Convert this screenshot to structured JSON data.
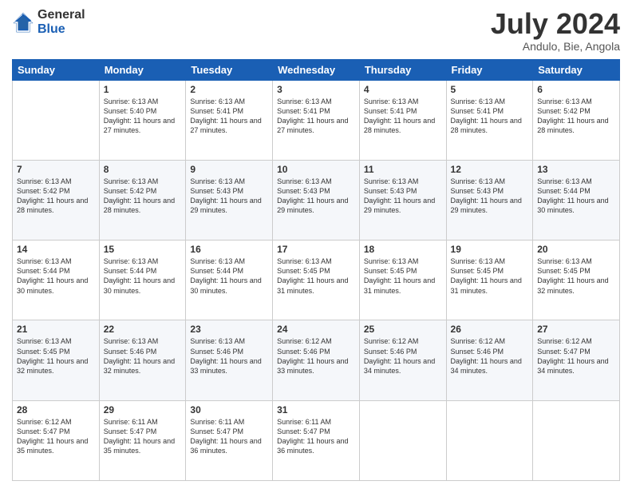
{
  "logo": {
    "general": "General",
    "blue": "Blue"
  },
  "header": {
    "month_year": "July 2024",
    "location": "Andulo, Bie, Angola"
  },
  "days_header": [
    "Sunday",
    "Monday",
    "Tuesday",
    "Wednesday",
    "Thursday",
    "Friday",
    "Saturday"
  ],
  "weeks": [
    [
      {
        "day": "",
        "sunrise": "",
        "sunset": "",
        "daylight": ""
      },
      {
        "day": "1",
        "sunrise": "Sunrise: 6:13 AM",
        "sunset": "Sunset: 5:40 PM",
        "daylight": "Daylight: 11 hours and 27 minutes."
      },
      {
        "day": "2",
        "sunrise": "Sunrise: 6:13 AM",
        "sunset": "Sunset: 5:41 PM",
        "daylight": "Daylight: 11 hours and 27 minutes."
      },
      {
        "day": "3",
        "sunrise": "Sunrise: 6:13 AM",
        "sunset": "Sunset: 5:41 PM",
        "daylight": "Daylight: 11 hours and 27 minutes."
      },
      {
        "day": "4",
        "sunrise": "Sunrise: 6:13 AM",
        "sunset": "Sunset: 5:41 PM",
        "daylight": "Daylight: 11 hours and 28 minutes."
      },
      {
        "day": "5",
        "sunrise": "Sunrise: 6:13 AM",
        "sunset": "Sunset: 5:41 PM",
        "daylight": "Daylight: 11 hours and 28 minutes."
      },
      {
        "day": "6",
        "sunrise": "Sunrise: 6:13 AM",
        "sunset": "Sunset: 5:42 PM",
        "daylight": "Daylight: 11 hours and 28 minutes."
      }
    ],
    [
      {
        "day": "7",
        "sunrise": "Sunrise: 6:13 AM",
        "sunset": "Sunset: 5:42 PM",
        "daylight": "Daylight: 11 hours and 28 minutes."
      },
      {
        "day": "8",
        "sunrise": "Sunrise: 6:13 AM",
        "sunset": "Sunset: 5:42 PM",
        "daylight": "Daylight: 11 hours and 28 minutes."
      },
      {
        "day": "9",
        "sunrise": "Sunrise: 6:13 AM",
        "sunset": "Sunset: 5:43 PM",
        "daylight": "Daylight: 11 hours and 29 minutes."
      },
      {
        "day": "10",
        "sunrise": "Sunrise: 6:13 AM",
        "sunset": "Sunset: 5:43 PM",
        "daylight": "Daylight: 11 hours and 29 minutes."
      },
      {
        "day": "11",
        "sunrise": "Sunrise: 6:13 AM",
        "sunset": "Sunset: 5:43 PM",
        "daylight": "Daylight: 11 hours and 29 minutes."
      },
      {
        "day": "12",
        "sunrise": "Sunrise: 6:13 AM",
        "sunset": "Sunset: 5:43 PM",
        "daylight": "Daylight: 11 hours and 29 minutes."
      },
      {
        "day": "13",
        "sunrise": "Sunrise: 6:13 AM",
        "sunset": "Sunset: 5:44 PM",
        "daylight": "Daylight: 11 hours and 30 minutes."
      }
    ],
    [
      {
        "day": "14",
        "sunrise": "Sunrise: 6:13 AM",
        "sunset": "Sunset: 5:44 PM",
        "daylight": "Daylight: 11 hours and 30 minutes."
      },
      {
        "day": "15",
        "sunrise": "Sunrise: 6:13 AM",
        "sunset": "Sunset: 5:44 PM",
        "daylight": "Daylight: 11 hours and 30 minutes."
      },
      {
        "day": "16",
        "sunrise": "Sunrise: 6:13 AM",
        "sunset": "Sunset: 5:44 PM",
        "daylight": "Daylight: 11 hours and 30 minutes."
      },
      {
        "day": "17",
        "sunrise": "Sunrise: 6:13 AM",
        "sunset": "Sunset: 5:45 PM",
        "daylight": "Daylight: 11 hours and 31 minutes."
      },
      {
        "day": "18",
        "sunrise": "Sunrise: 6:13 AM",
        "sunset": "Sunset: 5:45 PM",
        "daylight": "Daylight: 11 hours and 31 minutes."
      },
      {
        "day": "19",
        "sunrise": "Sunrise: 6:13 AM",
        "sunset": "Sunset: 5:45 PM",
        "daylight": "Daylight: 11 hours and 31 minutes."
      },
      {
        "day": "20",
        "sunrise": "Sunrise: 6:13 AM",
        "sunset": "Sunset: 5:45 PM",
        "daylight": "Daylight: 11 hours and 32 minutes."
      }
    ],
    [
      {
        "day": "21",
        "sunrise": "Sunrise: 6:13 AM",
        "sunset": "Sunset: 5:45 PM",
        "daylight": "Daylight: 11 hours and 32 minutes."
      },
      {
        "day": "22",
        "sunrise": "Sunrise: 6:13 AM",
        "sunset": "Sunset: 5:46 PM",
        "daylight": "Daylight: 11 hours and 32 minutes."
      },
      {
        "day": "23",
        "sunrise": "Sunrise: 6:13 AM",
        "sunset": "Sunset: 5:46 PM",
        "daylight": "Daylight: 11 hours and 33 minutes."
      },
      {
        "day": "24",
        "sunrise": "Sunrise: 6:12 AM",
        "sunset": "Sunset: 5:46 PM",
        "daylight": "Daylight: 11 hours and 33 minutes."
      },
      {
        "day": "25",
        "sunrise": "Sunrise: 6:12 AM",
        "sunset": "Sunset: 5:46 PM",
        "daylight": "Daylight: 11 hours and 34 minutes."
      },
      {
        "day": "26",
        "sunrise": "Sunrise: 6:12 AM",
        "sunset": "Sunset: 5:46 PM",
        "daylight": "Daylight: 11 hours and 34 minutes."
      },
      {
        "day": "27",
        "sunrise": "Sunrise: 6:12 AM",
        "sunset": "Sunset: 5:47 PM",
        "daylight": "Daylight: 11 hours and 34 minutes."
      }
    ],
    [
      {
        "day": "28",
        "sunrise": "Sunrise: 6:12 AM",
        "sunset": "Sunset: 5:47 PM",
        "daylight": "Daylight: 11 hours and 35 minutes."
      },
      {
        "day": "29",
        "sunrise": "Sunrise: 6:11 AM",
        "sunset": "Sunset: 5:47 PM",
        "daylight": "Daylight: 11 hours and 35 minutes."
      },
      {
        "day": "30",
        "sunrise": "Sunrise: 6:11 AM",
        "sunset": "Sunset: 5:47 PM",
        "daylight": "Daylight: 11 hours and 36 minutes."
      },
      {
        "day": "31",
        "sunrise": "Sunrise: 6:11 AM",
        "sunset": "Sunset: 5:47 PM",
        "daylight": "Daylight: 11 hours and 36 minutes."
      },
      {
        "day": "",
        "sunrise": "",
        "sunset": "",
        "daylight": ""
      },
      {
        "day": "",
        "sunrise": "",
        "sunset": "",
        "daylight": ""
      },
      {
        "day": "",
        "sunrise": "",
        "sunset": "",
        "daylight": ""
      }
    ]
  ]
}
